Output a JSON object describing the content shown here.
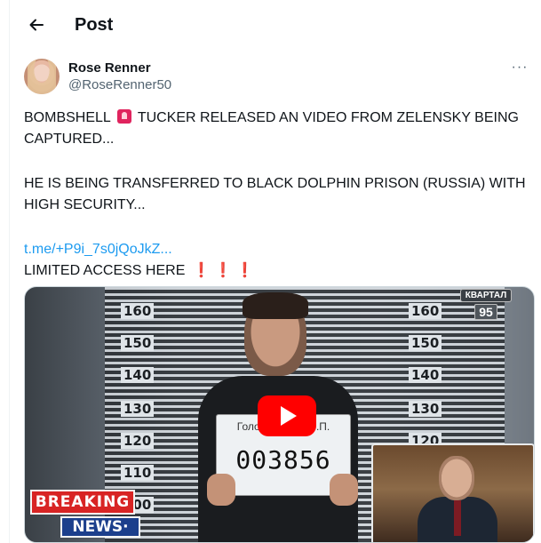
{
  "header": {
    "back_icon": "arrow-left-icon",
    "title": "Post"
  },
  "post": {
    "author": {
      "display_name": "Rose Renner",
      "handle": "@RoseRenner50"
    },
    "more_icon": "more-horizontal-icon",
    "more_label": "···",
    "text_line1a": "BOMBSHELL",
    "text_line1b": "TUCKER RELEASED AN VIDEO FROM ZELENSKY BEING CAPTURED...",
    "text_para2": "HE IS BEING TRANSFERRED TO BLACK DOLPHIN PRISON (RUSSIA) WITH HIGH SECURITY...",
    "link_text": "t.me/+P9i_7s0jQoJkZ...",
    "text_last": "LIMITED ACCESS HERE",
    "exclamations": "❗ ❗ ❗",
    "siren_icon": "police-light-emoji"
  },
  "media": {
    "height_marks_left": [
      "160",
      "150",
      "140",
      "130",
      "120",
      "110",
      "100"
    ],
    "height_marks_right": [
      "160",
      "150",
      "140",
      "130",
      "120"
    ],
    "placard_name": "Голобородько В.П.",
    "placard_number": "003856",
    "channel_logo_top": "КВАРТАЛ",
    "channel_logo_number": "95",
    "play_icon": "play-button-icon",
    "breaking_top": "BREAKING",
    "breaking_bottom": "NEWS·",
    "colors": {
      "breaking_red": "#d82424",
      "news_blue": "#1c3f8c",
      "play_red": "#ff0000"
    }
  },
  "colors": {
    "link": "#1d9bf0",
    "secondary_text": "#536471",
    "primary_text": "#0f1419"
  }
}
